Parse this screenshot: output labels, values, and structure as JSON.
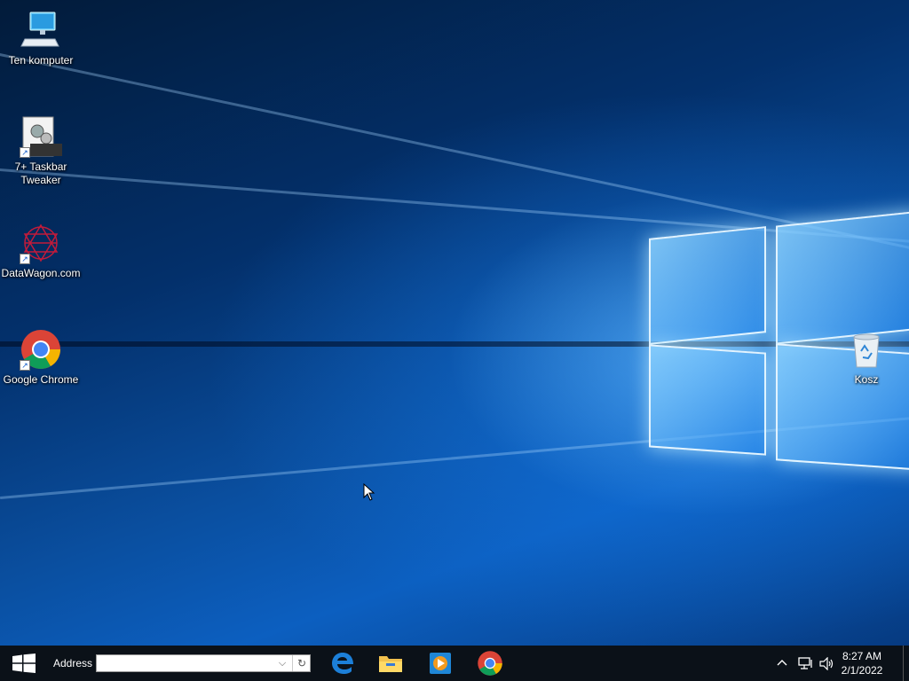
{
  "desktop": {
    "icons": [
      {
        "label": "Ten komputer"
      },
      {
        "label": "7+ Taskbar Tweaker"
      },
      {
        "label": "DataWagon.com"
      },
      {
        "label": "Google Chrome"
      },
      {
        "label": "Kosz"
      }
    ]
  },
  "taskbar": {
    "address_label": "Address",
    "address_value": "",
    "apps": [
      {
        "icon": "edge-icon"
      },
      {
        "icon": "file-explorer-icon"
      },
      {
        "icon": "media-player-icon"
      },
      {
        "icon": "chrome-icon"
      }
    ],
    "tray": {
      "time": "8:27 AM",
      "date": "2/1/2022"
    }
  },
  "colors": {
    "taskbar_bg": "#0b1118",
    "wallpaper_accent": "#0c5fc0"
  }
}
